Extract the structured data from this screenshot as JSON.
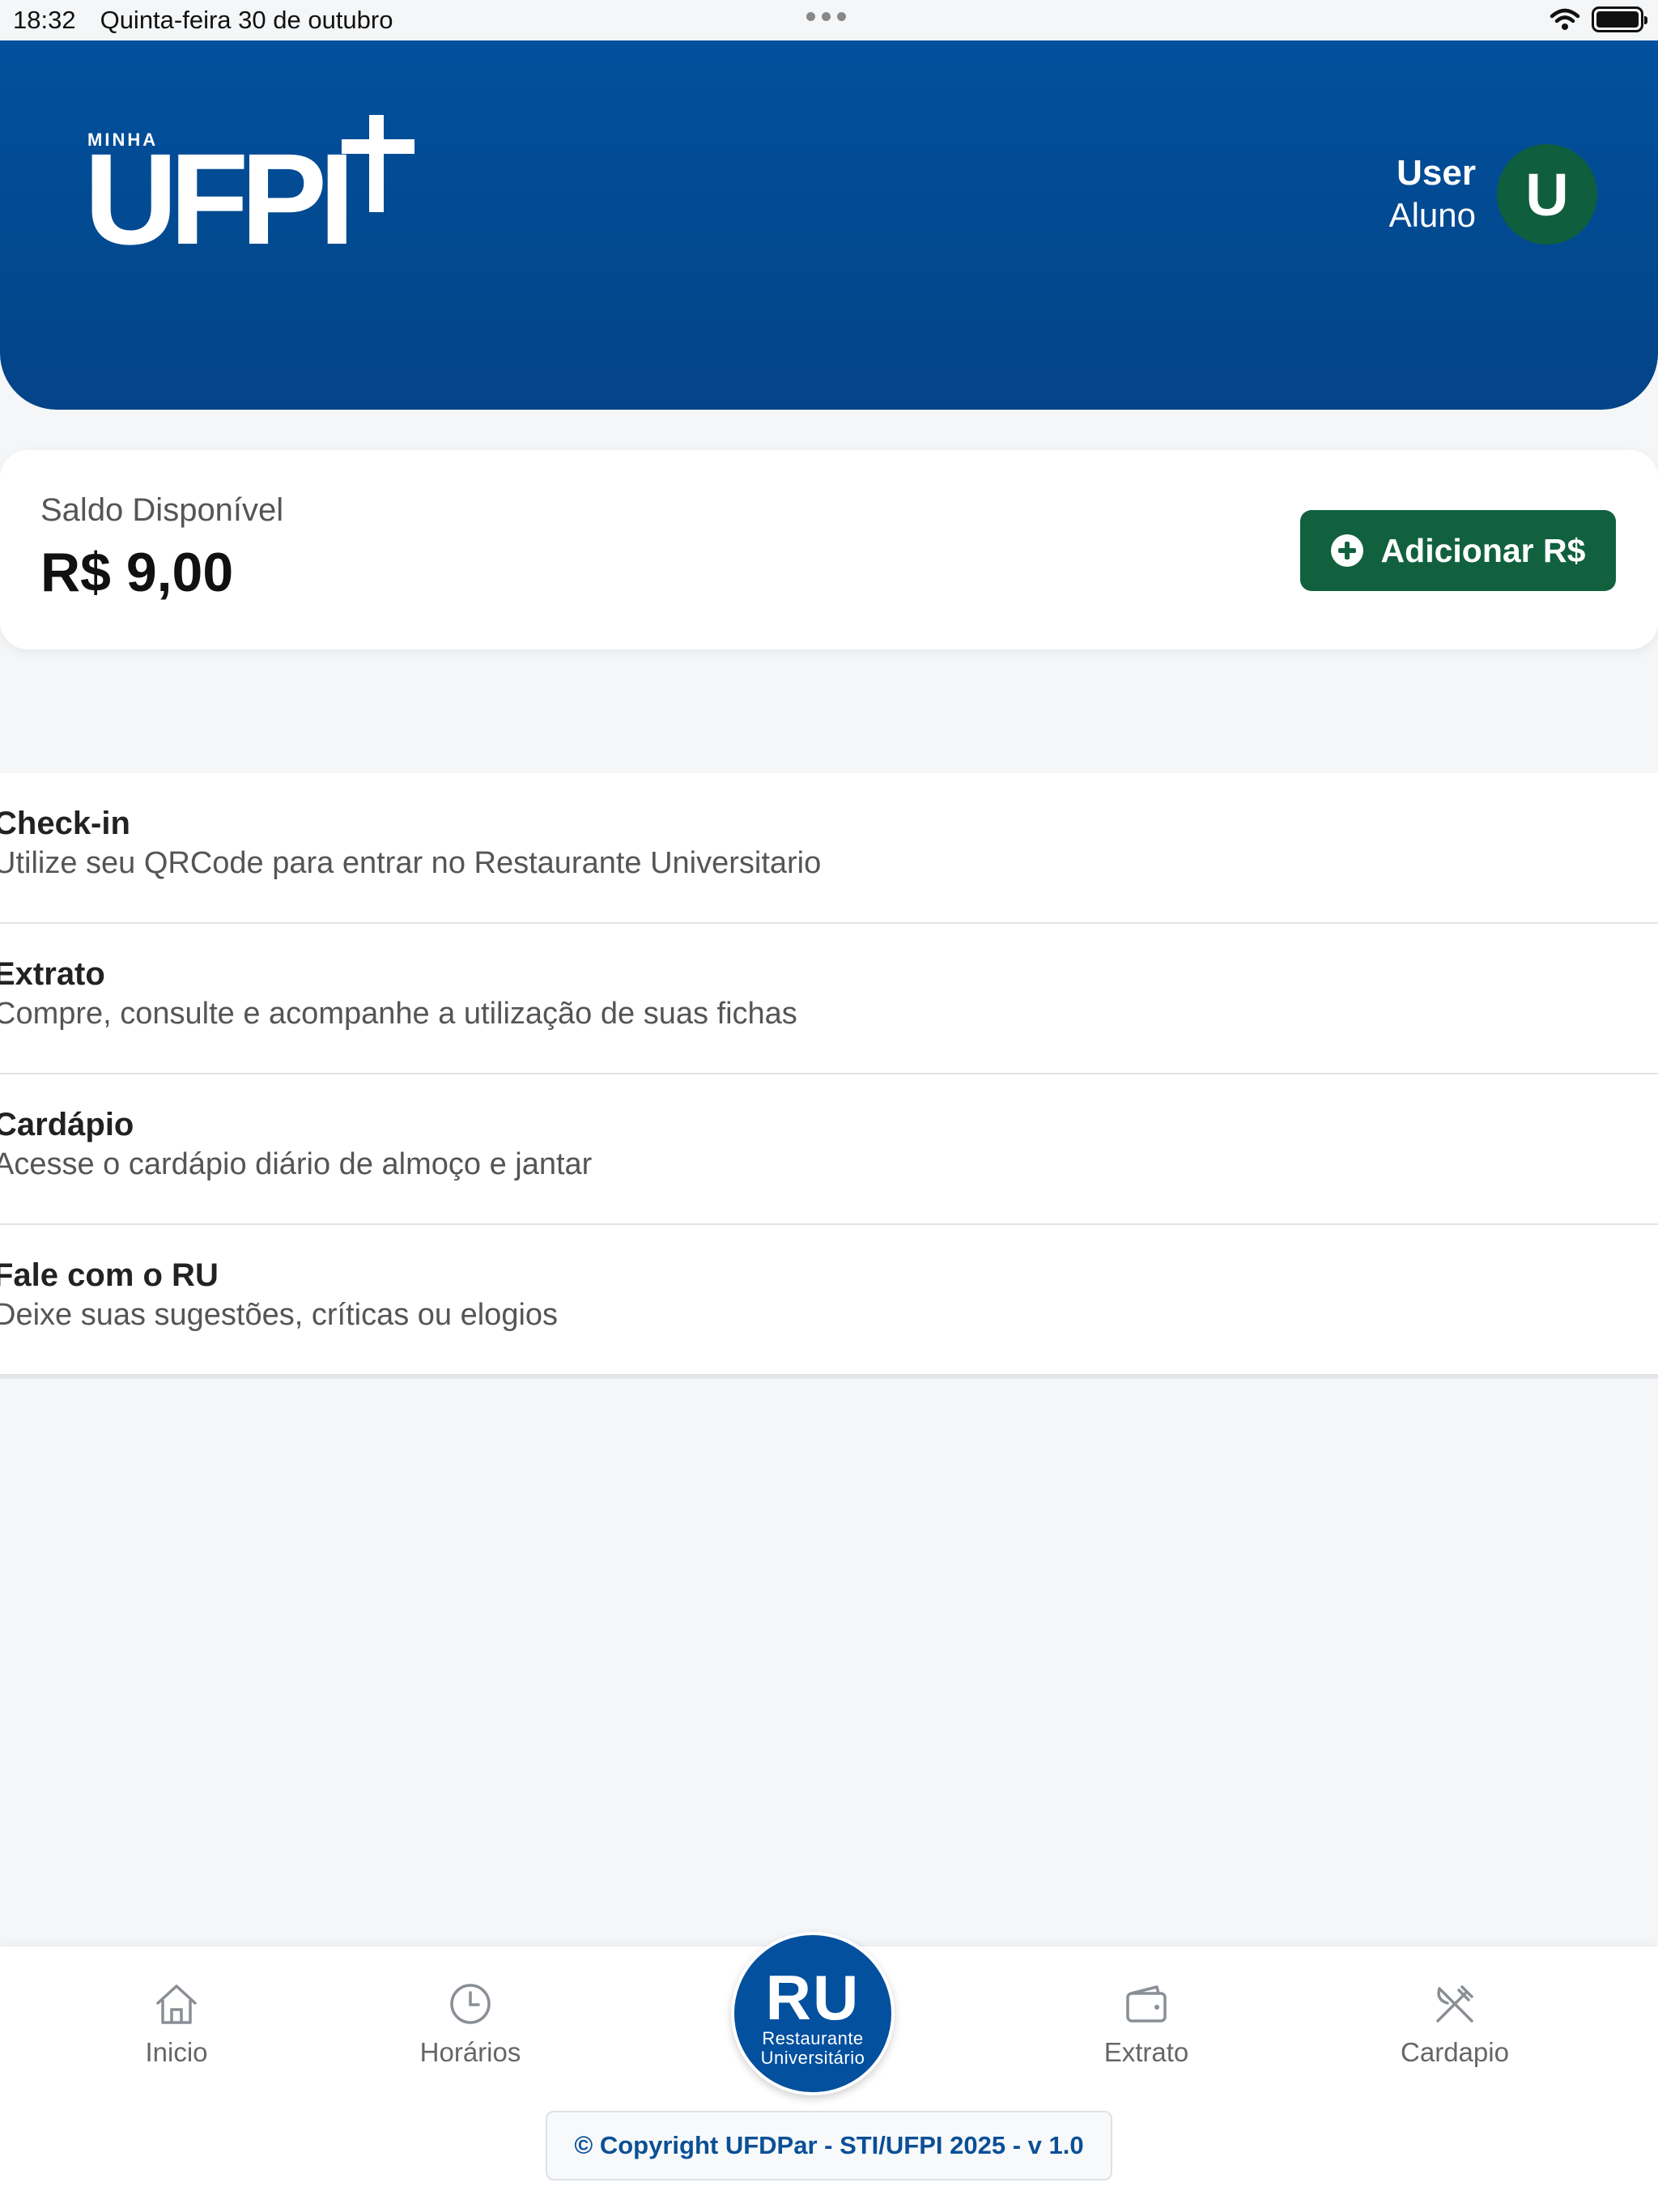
{
  "status_bar": {
    "time": "18:32",
    "date": "Quinta-feira 30 de outubro"
  },
  "header": {
    "logo_small": "MINHA",
    "logo_big": "UFPI",
    "user_name": "User",
    "user_role": "Aluno",
    "avatar_initial": "U",
    "colors": {
      "header_blue": "#02509e",
      "avatar_green": "#0f5e3d"
    }
  },
  "balance": {
    "label": "Saldo Disponível",
    "value": "R$ 9,00",
    "add_button_label": "Adicionar R$",
    "button_color": "#11613f"
  },
  "menu": {
    "items": [
      {
        "title": "Check-in",
        "description": "Utilize seu QRCode para entrar no Restaurante Universitario"
      },
      {
        "title": "Extrato",
        "description": "Compre, consulte e acompanhe a utilização de suas fichas"
      },
      {
        "title": "Cardápio",
        "description": "Acesse o cardápio diário de almoço e jantar"
      },
      {
        "title": "Fale com o RU",
        "description": "Deixe suas sugestões, críticas ou elogios"
      }
    ]
  },
  "bottom_nav": {
    "items": [
      {
        "label": "Inicio",
        "icon": "home-icon"
      },
      {
        "label": "Horários",
        "icon": "clock-icon"
      },
      {
        "label": "Extrato",
        "icon": "wallet-icon"
      },
      {
        "label": "Cardapio",
        "icon": "cutlery-icon"
      }
    ],
    "center": {
      "big": "RU",
      "line1": "Restaurante",
      "line2": "Universitário"
    }
  },
  "footer": {
    "copyright": "© Copyright UFDPar - STI/UFPI 2025 - v 1.0"
  }
}
